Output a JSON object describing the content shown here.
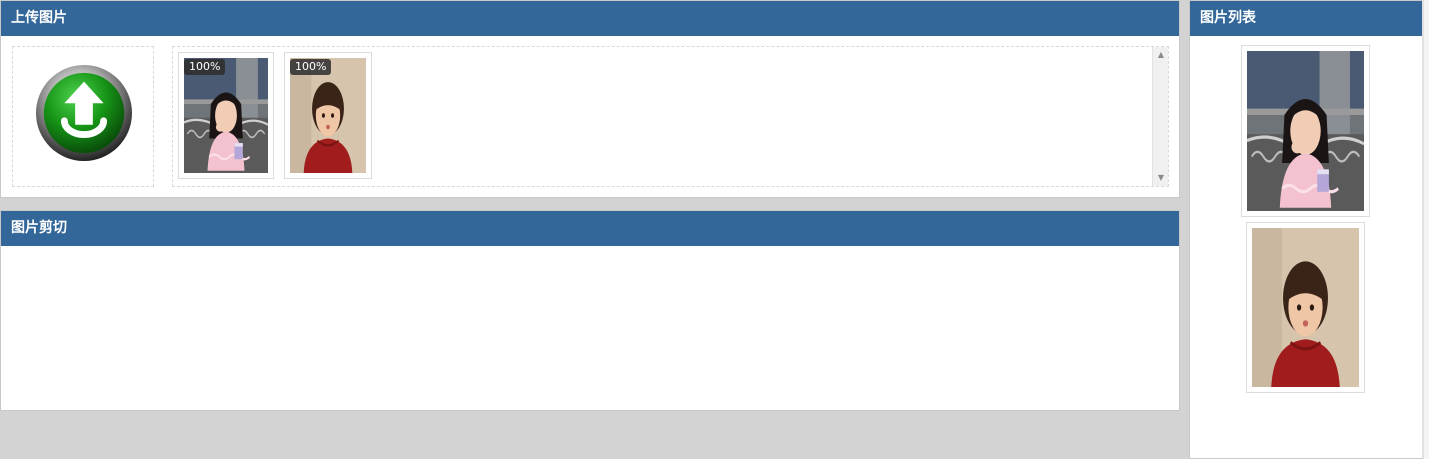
{
  "upload_panel": {
    "title": "上传图片",
    "thumbnails": [
      {
        "progress_label": "100%",
        "subject": "girl-eating-snack-photo"
      },
      {
        "progress_label": "100%",
        "subject": "child-red-sweater-photo"
      }
    ]
  },
  "crop_panel": {
    "title": "图片剪切"
  },
  "list_panel": {
    "title": "图片列表",
    "images": [
      {
        "subject": "girl-eating-snack-photo"
      },
      {
        "subject": "child-red-sweater-photo"
      }
    ]
  },
  "colors": {
    "header_bg": "#336699",
    "header_text": "#ffffff",
    "page_bg": "#d3d3d3",
    "upload_icon_green": "#1f9a1f"
  }
}
